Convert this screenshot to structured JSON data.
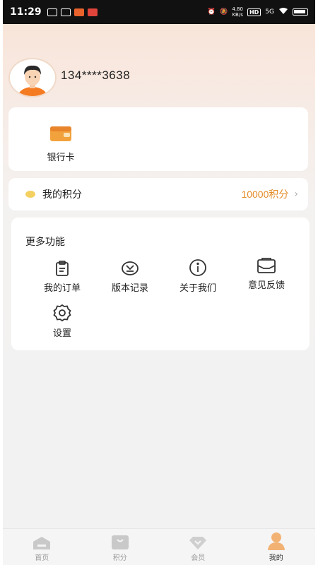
{
  "status_bar": {
    "time": "11:29",
    "net_speed_value": "4.80",
    "net_speed_unit": "KB/s",
    "hd_label": "HD",
    "signal_label": "5G"
  },
  "profile": {
    "phone": "134****3638",
    "avatar_icon": "user-avatar-icon"
  },
  "bank_card": {
    "label": "银行卡",
    "icon": "wallet-icon"
  },
  "points": {
    "label": "我的积分",
    "value": "10000积分",
    "icon": "coin-icon"
  },
  "more_features": {
    "title": "更多功能",
    "items": [
      {
        "label": "我的订单",
        "icon": "clipboard-icon"
      },
      {
        "label": "版本记录",
        "icon": "version-icon"
      },
      {
        "label": "关于我们",
        "icon": "info-icon"
      },
      {
        "label": "意见反馈",
        "icon": "mail-icon"
      },
      {
        "label": "设置",
        "icon": "gear-icon"
      }
    ]
  },
  "tabs": [
    {
      "label": "首页",
      "icon": "home-icon",
      "active": false
    },
    {
      "label": "积分",
      "icon": "bag-icon",
      "active": false
    },
    {
      "label": "会员",
      "icon": "diamond-icon",
      "active": false
    },
    {
      "label": "我的",
      "icon": "person-icon",
      "active": true
    }
  ],
  "colors": {
    "accent_orange": "#e38b24",
    "header_gradient_top": "#f9e3d6"
  }
}
